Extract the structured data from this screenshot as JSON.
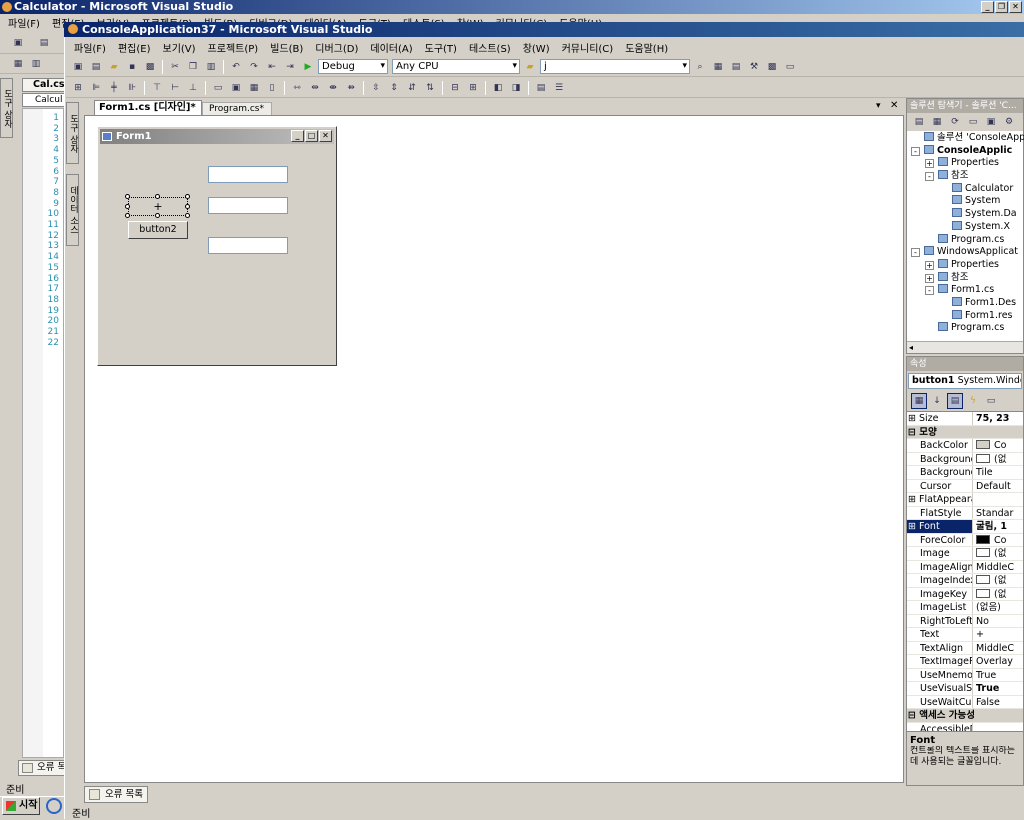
{
  "outer_window": {
    "title": "Calculator - Microsoft Visual Studio"
  },
  "outer_menu": [
    "파일(F)",
    "편집(E)",
    "보기(V)",
    "프로젝트(P)",
    "빌드(B)",
    "디버그(D)",
    "데이터(A)",
    "도구(T)",
    "테스트(S)",
    "창(W)",
    "커뮤니티(C)",
    "도움말(H)"
  ],
  "outer_tabs": {
    "cal_tab": "Cal.cs",
    "calcul_tab": "Calcul"
  },
  "outer_status": {
    "status": "준비",
    "start": "시작",
    "error_list": "오류 목"
  },
  "inner_window": {
    "title": "ConsoleApplication37 - Microsoft Visual Studio"
  },
  "inner_menu": [
    "파일(F)",
    "편집(E)",
    "보기(V)",
    "프로젝트(P)",
    "빌드(B)",
    "디버그(D)",
    "데이터(A)",
    "도구(T)",
    "테스트(S)",
    "창(W)",
    "커뮤니티(C)",
    "도움말(H)"
  ],
  "toolbar": {
    "config": "Debug",
    "platform": "Any CPU",
    "find": "j"
  },
  "doc_tabs": [
    {
      "label": "Form1.cs [디자인]*",
      "active": true
    },
    {
      "label": "Program.cs*",
      "active": false
    }
  ],
  "side_tabs": {
    "toolbox": "도구 상자",
    "datasource": "데이터 소스",
    "outer_toolbox": "도구 상자"
  },
  "line_numbers": [
    "1",
    "2",
    "3",
    "4",
    "5",
    "6",
    "7",
    "8",
    "9",
    "10",
    "11",
    "12",
    "13",
    "14",
    "15",
    "16",
    "17",
    "18",
    "19",
    "20",
    "21",
    "22"
  ],
  "form": {
    "title": "Form1",
    "button1_text": "+",
    "button2_text": "button2"
  },
  "solution_explorer": {
    "title": "솔루션 탐색기 - 솔루션 'C...",
    "items": [
      {
        "label": "솔루션 'ConsoleApp",
        "level": 0,
        "exp": ""
      },
      {
        "label": "ConsoleApplic",
        "level": 0,
        "exp": "-",
        "bold": true
      },
      {
        "label": "Properties",
        "level": 1,
        "exp": "+"
      },
      {
        "label": "참조",
        "level": 1,
        "exp": "-"
      },
      {
        "label": "Calculator",
        "level": 2,
        "exp": ""
      },
      {
        "label": "System",
        "level": 2,
        "exp": ""
      },
      {
        "label": "System.Da",
        "level": 2,
        "exp": ""
      },
      {
        "label": "System.X",
        "level": 2,
        "exp": ""
      },
      {
        "label": "Program.cs",
        "level": 1,
        "exp": ""
      },
      {
        "label": "WindowsApplicat",
        "level": 0,
        "exp": "-"
      },
      {
        "label": "Properties",
        "level": 1,
        "exp": "+"
      },
      {
        "label": "참조",
        "level": 1,
        "exp": "+"
      },
      {
        "label": "Form1.cs",
        "level": 1,
        "exp": "-"
      },
      {
        "label": "Form1.Des",
        "level": 2,
        "exp": ""
      },
      {
        "label": "Form1.res",
        "level": 2,
        "exp": ""
      },
      {
        "label": "Program.cs",
        "level": 1,
        "exp": ""
      }
    ]
  },
  "properties": {
    "title": "속성",
    "object": "button1",
    "object_type": "System.Window",
    "rows": [
      {
        "name": "Size",
        "value": "75, 23",
        "exp": "+",
        "bold": true
      },
      {
        "name": "모양",
        "cat": true
      },
      {
        "name": "BackColor",
        "value": "Co",
        "swatch": "#d4d0c8"
      },
      {
        "name": "BackgroundIm",
        "value": "(없",
        "swatch": "#ffffff"
      },
      {
        "name": "BackgroundIm",
        "value": "Tile"
      },
      {
        "name": "Cursor",
        "value": "Default"
      },
      {
        "name": "FlatAppearanc",
        "value": "",
        "exp": "+"
      },
      {
        "name": "FlatStyle",
        "value": "Standar"
      },
      {
        "name": "Font",
        "value": "굴림, 1",
        "exp": "+",
        "sel": true,
        "bold": true
      },
      {
        "name": "ForeColor",
        "value": "Co",
        "swatch": "#000000"
      },
      {
        "name": "Image",
        "value": "(없",
        "swatch": "#ffffff"
      },
      {
        "name": "ImageAlign",
        "value": "MiddleC"
      },
      {
        "name": "ImageIndex",
        "value": "(없",
        "swatch": "#ffffff"
      },
      {
        "name": "ImageKey",
        "value": "(없",
        "swatch": "#ffffff"
      },
      {
        "name": "ImageList",
        "value": "(없음)"
      },
      {
        "name": "RightToLeft",
        "value": "No"
      },
      {
        "name": "Text",
        "value": "+"
      },
      {
        "name": "TextAlign",
        "value": "MiddleC"
      },
      {
        "name": "TextImageRel",
        "value": "Overlay"
      },
      {
        "name": "UseMnemonic",
        "value": "True"
      },
      {
        "name": "UseVisualStyle",
        "value": "True",
        "bold": true
      },
      {
        "name": "UseWaitCurso",
        "value": "False"
      },
      {
        "name": "액세스 가능성",
        "cat": true
      },
      {
        "name": "AccessibleDe",
        "value": ""
      }
    ],
    "desc_title": "Font",
    "desc_text": "컨트롤의 텍스트를 표시하는 데 사용되는 글꼴입니다."
  },
  "bottom": {
    "error_list": "오류 목록",
    "status": "준비"
  }
}
